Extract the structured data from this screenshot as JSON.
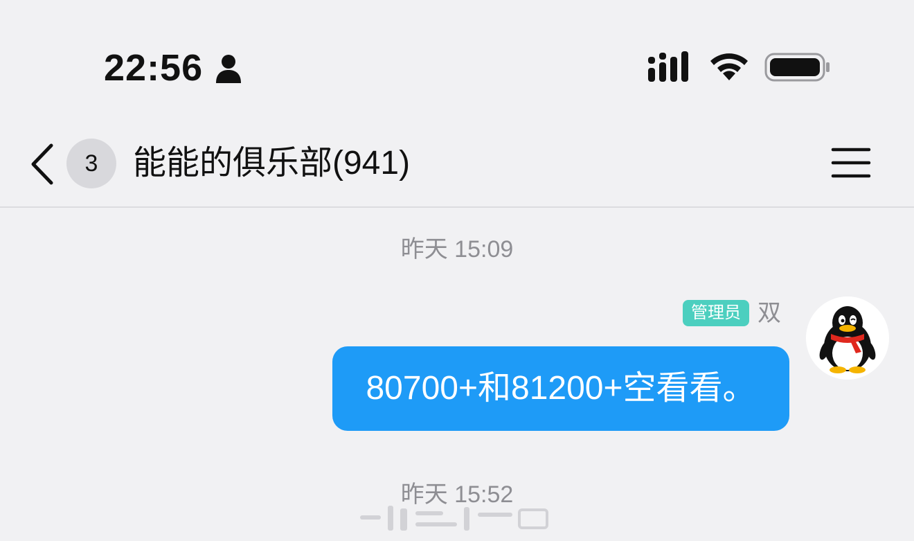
{
  "status_bar": {
    "time": "22:56",
    "icons": [
      "person-icon",
      "signal-icon",
      "wifi-icon",
      "battery-icon"
    ]
  },
  "nav": {
    "back_icon": "chevron-left-icon",
    "unread_count": "3",
    "title": "能能的俱乐部(941)",
    "menu_icon": "hamburger-menu-icon"
  },
  "messages": [
    {
      "timestamp": "昨天 15:09",
      "role_badge": "管理员",
      "sender": "双",
      "avatar_icon": "penguin-avatar-icon",
      "text": "80700+和81200+空看看。"
    }
  ],
  "next_timestamp": "昨天 15:52",
  "colors": {
    "background": "#f1f1f3",
    "bubble": "#1e9bf7",
    "role_badge": "#4ccfbf",
    "timestamp": "#8e8e93"
  }
}
